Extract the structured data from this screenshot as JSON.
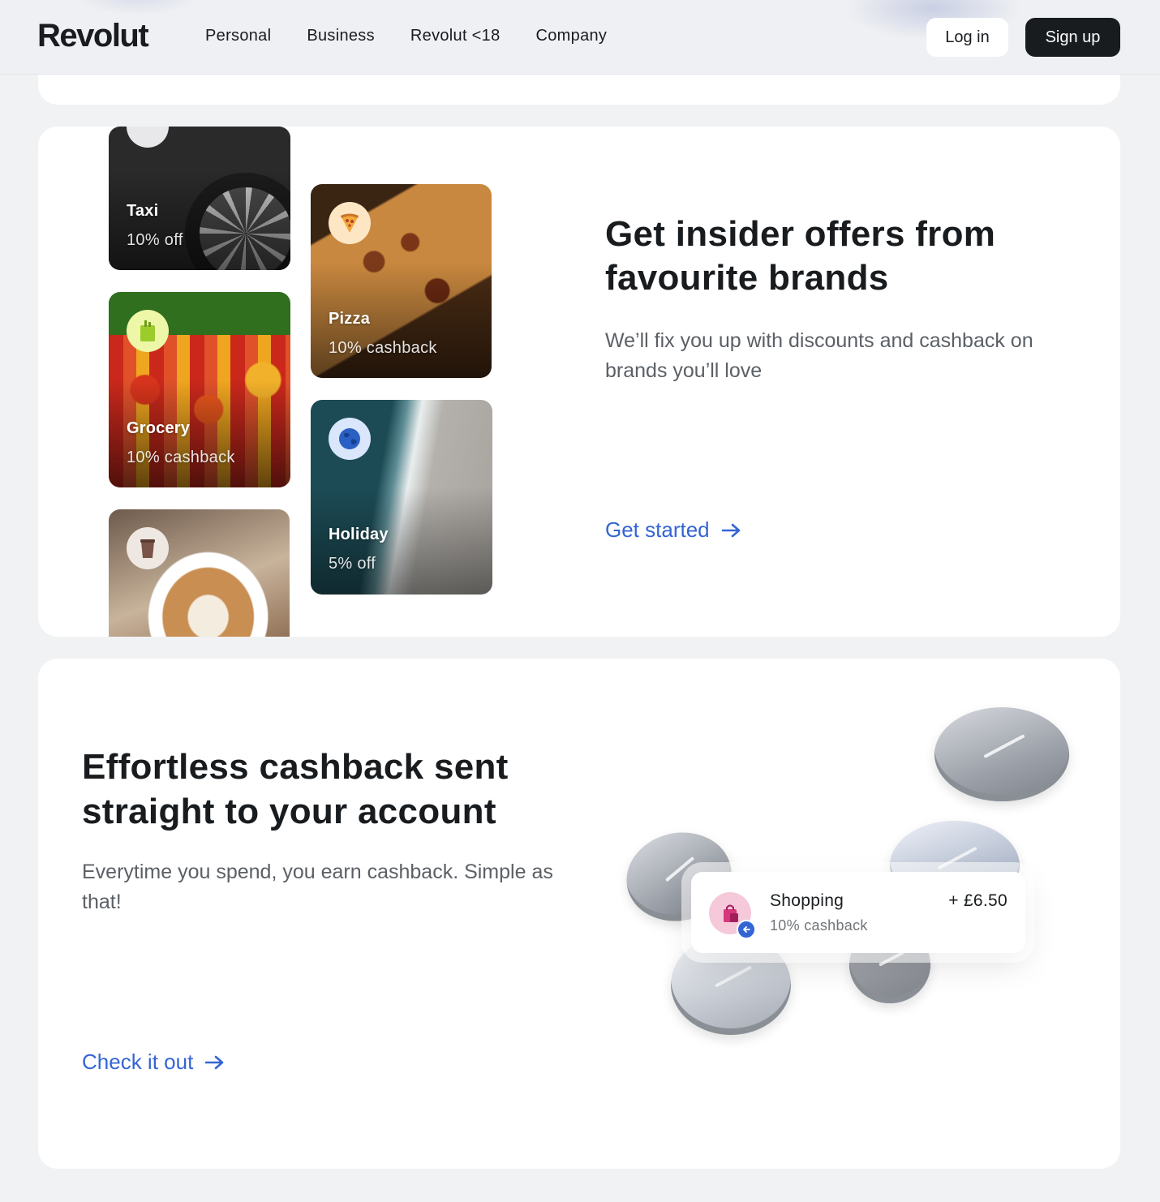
{
  "header": {
    "logo": "Revolut",
    "nav": [
      "Personal",
      "Business",
      "Revolut <18",
      "Company"
    ],
    "login_label": "Log in",
    "signup_label": "Sign up"
  },
  "offers": {
    "title": "Get insider offers from favourite brands",
    "description": "We’ll fix you up with discounts and cashback on brands you’ll love",
    "cta": "Get started",
    "tiles": [
      {
        "label": "Taxi",
        "sub": "10% off",
        "icon": "car-icon"
      },
      {
        "label": "Grocery",
        "sub": "10% cashback",
        "icon": "grocery-bag-icon"
      },
      {
        "label": "",
        "sub": "",
        "icon": "coffee-cup-icon"
      },
      {
        "label": "Pizza",
        "sub": "10% cashback",
        "icon": "pizza-slice-icon"
      },
      {
        "label": "Holiday",
        "sub": "5% off",
        "icon": "globe-icon"
      }
    ]
  },
  "cashback": {
    "title": "Effortless cashback sent straight to your account",
    "description": "Everytime you spend, you earn cashback. Simple as that!",
    "cta": "Check it out",
    "transaction": {
      "name": "Shopping",
      "sub": "10% cashback",
      "amount": "+ £6.50",
      "icon": "shopping-bag-icon"
    }
  },
  "colors": {
    "accent": "#3465d4",
    "text": "#191c1f",
    "muted": "#5b6066",
    "background": "#f1f2f4"
  }
}
